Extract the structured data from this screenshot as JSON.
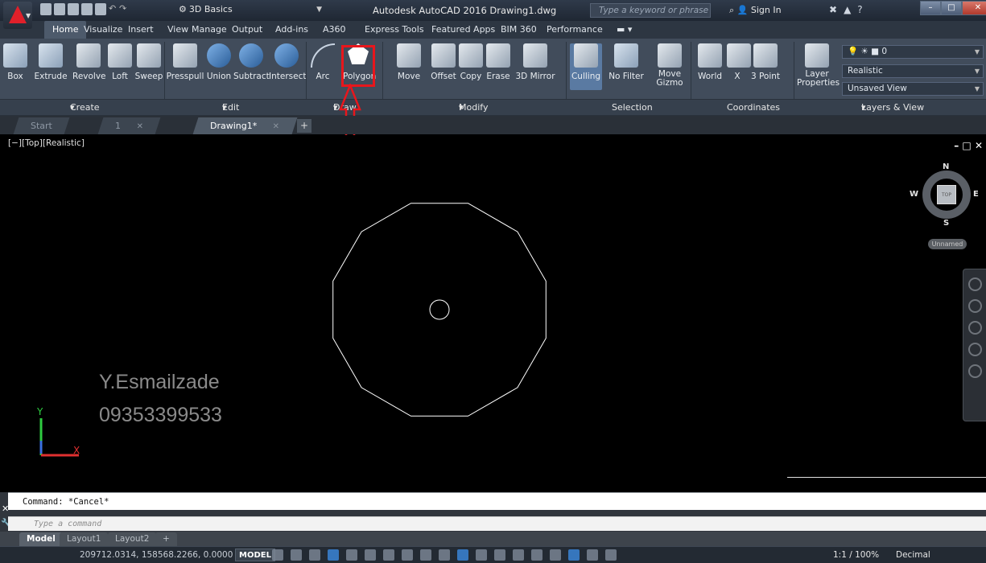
{
  "titlebar": {
    "workspace": "3D Basics",
    "app_title": "Autodesk AutoCAD 2016   Drawing1.dwg",
    "search_placeholder": "Type a keyword or phrase",
    "sign_in": "Sign In"
  },
  "ribbon_tabs": [
    "Home",
    "Visualize",
    "Insert",
    "View",
    "Manage",
    "Output",
    "Add-ins",
    "A360",
    "Express Tools",
    "Featured Apps",
    "BIM 360",
    "Performance"
  ],
  "ribbon": {
    "create_tools": [
      "Box",
      "Extrude",
      "Revolve",
      "Loft",
      "Sweep"
    ],
    "edit_tools": [
      "Presspull",
      "Union",
      "Subtract",
      "Intersect"
    ],
    "draw_tools": [
      "Arc",
      "Polygon"
    ],
    "modify_tools": [
      "Move",
      "Offset",
      "Copy",
      "Erase",
      "3D Mirror"
    ],
    "selection_tools": [
      "Culling",
      "No Filter",
      "Move Gizmo"
    ],
    "coordinate_tools": [
      "World",
      "X",
      "3 Point"
    ],
    "layer_properties": "Layer Properties",
    "layer_value": "0",
    "visual_style": "Realistic",
    "view_name": "Unsaved View",
    "panels": [
      "Create",
      "Edit",
      "Draw",
      "Modify",
      "Selection",
      "Coordinates",
      "Layers & View"
    ]
  },
  "file_tabs": {
    "start": "Start",
    "tab1": "1",
    "active": "Drawing1*"
  },
  "viewport": {
    "label": "[−][Top][Realistic]",
    "controls": "– □ ✕",
    "viewcube_face": "TOP",
    "compass": {
      "n": "N",
      "s": "S",
      "e": "E",
      "w": "W"
    },
    "ucs_name": "Unnamed",
    "watermark_name": "Y.Esmailzade",
    "watermark_phone": "09353399533",
    "polygon_sides": 12,
    "ucs_x": "X",
    "ucs_y": "Y"
  },
  "command": {
    "history": "Command: *Cancel*",
    "placeholder": "Type a command"
  },
  "layout_tabs": [
    "Model",
    "Layout1",
    "Layout2"
  ],
  "status": {
    "coordinates": "209712.0314, 158568.2266, 0.0000",
    "mode": "MODEL",
    "scale": "1:1 / 100%",
    "units": "Decimal"
  },
  "colors": {
    "highlight": "#e8161c",
    "ribbon_bg": "#414c5b",
    "canvas_bg": "#000000"
  }
}
